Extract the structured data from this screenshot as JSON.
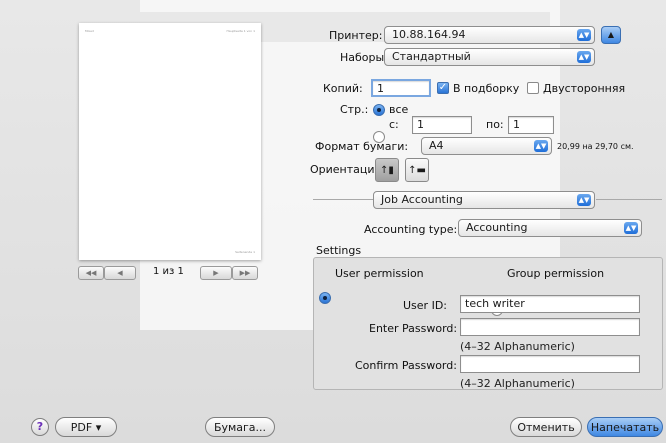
{
  "preview": {
    "page_header_left": "Mixed",
    "page_header_right": "Hauptseite 1 von 1",
    "page_footer_right": "Seitenende 1",
    "page_counter": "1 из 1",
    "nav": {
      "first": "◀◀",
      "prev": "◀",
      "next": "▶",
      "last": "▶▶"
    }
  },
  "printer": {
    "label": "Принтер:",
    "value": "10.88.164.94",
    "toggle_icon": "▲"
  },
  "presets": {
    "label": "Наборы:",
    "value": "Стандартный"
  },
  "copies": {
    "label": "Копий:",
    "value": "1",
    "collate_label": "В подборку",
    "collate_checked": true,
    "duplex_label": "Двусторонняя",
    "duplex_checked": false
  },
  "pages": {
    "label": "Стр.:",
    "all_label": "все",
    "from_label": "с:",
    "from_value": "1",
    "to_label": "по:",
    "to_value": "1"
  },
  "paper": {
    "label": "Формат бумаги:",
    "value": "A4",
    "size_text": "20,99 на 29,70 см."
  },
  "orientation": {
    "label": "Ориентация:",
    "portrait_icon": "portrait-orientation-icon",
    "landscape_icon": "landscape-orientation-icon"
  },
  "section_popup": {
    "value": "Job Accounting"
  },
  "accounting": {
    "label": "Accounting type:",
    "value": "Accounting"
  },
  "settings": {
    "title": "Settings",
    "user_permission": "User permission",
    "group_permission": "Group permission",
    "user_id_label": "User ID:",
    "user_id_value": "tech writer",
    "password_label": "Enter Password:",
    "password_value": "",
    "password_hint": "(4–32 Alphanumeric)",
    "confirm_label": "Confirm Password:",
    "confirm_value": "",
    "confirm_hint": "(4–32 Alphanumeric)"
  },
  "footer": {
    "help": "?",
    "pdf": "PDF ▾",
    "paper_button": "Бумага...",
    "cancel": "Отменить",
    "print": "Напечатать"
  },
  "colors": {
    "accent": "#3f88e3",
    "help_glyph": "#6b2fb8"
  }
}
